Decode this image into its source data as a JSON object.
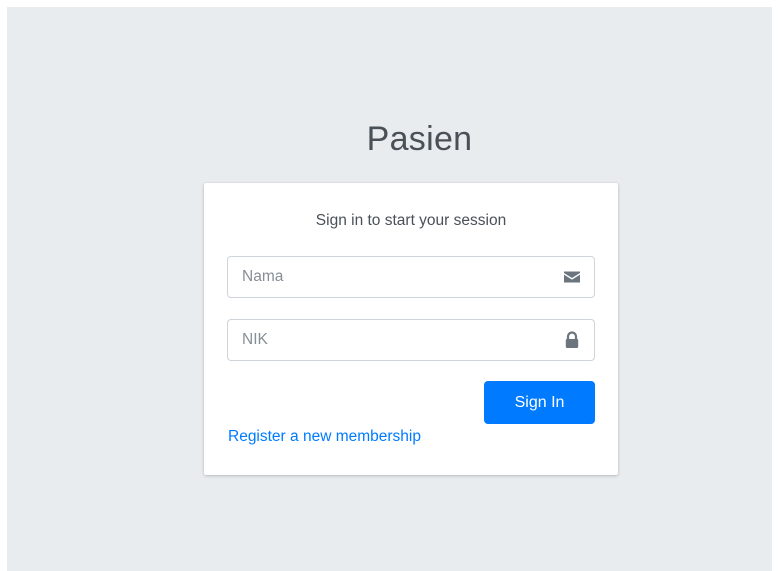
{
  "login": {
    "logo_text": "Pasien",
    "message": "Sign in to start your session",
    "nama": {
      "placeholder": "Nama",
      "value": "",
      "icon": "envelope-icon"
    },
    "nik": {
      "placeholder": "NIK",
      "value": "",
      "icon": "lock-icon"
    },
    "sign_in_label": "Sign In",
    "register_label": "Register a new membership"
  },
  "colors": {
    "background": "#e9ecef",
    "card": "#ffffff",
    "primary": "#007bff",
    "text": "#495057",
    "icon": "#6c757d",
    "input_border": "#ced4da"
  }
}
